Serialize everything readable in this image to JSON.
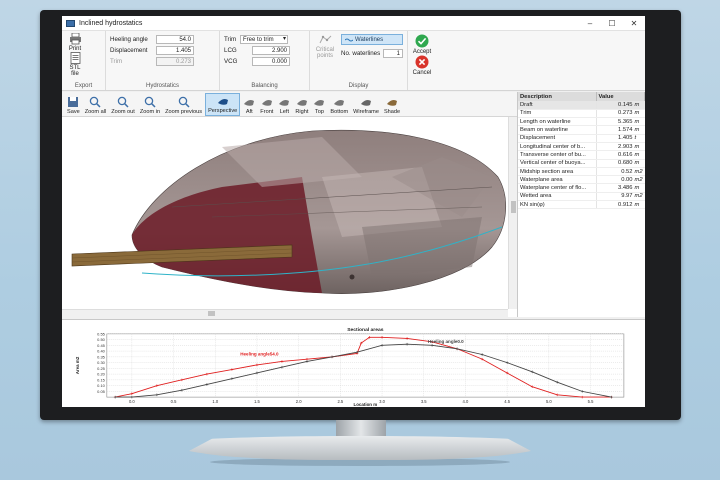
{
  "window": {
    "title": "Inclined hydrostatics",
    "controls": [
      "–",
      "☐",
      "✕"
    ]
  },
  "ribbon": {
    "export": {
      "label": "Export",
      "print": "Print",
      "stl": "STL file"
    },
    "hydrostatics": {
      "label": "Hydrostatics",
      "heeling_label": "Heeling angle",
      "heeling_value": "54.0",
      "displacement_label": "Displacement",
      "displacement_value": "1.405",
      "trim_label": "Trim",
      "trim_value": "0.273"
    },
    "balancing": {
      "label": "Balancing",
      "trim_label": "Trim",
      "trim_select": "Free to trim",
      "lcg_label": "LCG",
      "lcg_value": "2.900",
      "vcg_label": "VCG",
      "vcg_value": "0.000"
    },
    "display": {
      "label": "Display",
      "critical_points": "Critical points",
      "waterlines": "Waterlines",
      "nwl_label": "No. waterlines",
      "nwl_value": "1"
    },
    "actions": {
      "accept": "Accept",
      "cancel": "Cancel"
    }
  },
  "view_toolbar": [
    {
      "label": "Save",
      "icon": "save-icon"
    },
    {
      "label": "Zoom all",
      "icon": "zoom-all-icon"
    },
    {
      "label": "Zoom out",
      "icon": "zoom-out-icon"
    },
    {
      "label": "Zoom in",
      "icon": "zoom-in-icon"
    },
    {
      "label": "Zoom previous",
      "icon": "zoom-previous-icon"
    },
    {
      "label": "Perspective",
      "icon": "perspective-icon",
      "active": true
    },
    {
      "label": "Aft",
      "icon": "aft-view-icon"
    },
    {
      "label": "Front",
      "icon": "front-view-icon"
    },
    {
      "label": "Left",
      "icon": "left-view-icon"
    },
    {
      "label": "Right",
      "icon": "right-view-icon"
    },
    {
      "label": "Top",
      "icon": "top-view-icon"
    },
    {
      "label": "Bottom",
      "icon": "bottom-view-icon"
    },
    {
      "label": "Wireframe",
      "icon": "wireframe-icon"
    },
    {
      "label": "Shade",
      "icon": "shade-icon"
    }
  ],
  "properties": {
    "headers": [
      "Description",
      "Value"
    ],
    "rows": [
      [
        "Draft",
        "0.145",
        "m"
      ],
      [
        "Trim",
        "0.273",
        "m"
      ],
      [
        "Length on waterline",
        "5.365",
        "m"
      ],
      [
        "Beam on waterline",
        "1.574",
        "m"
      ],
      [
        "Displacement",
        "1.405",
        "t"
      ],
      [
        "Longitudinal center of b...",
        "2.903",
        "m"
      ],
      [
        "Transverse center of bu...",
        "0.616",
        "m"
      ],
      [
        "Vertical center of buoya...",
        "0.680",
        "m"
      ],
      [
        "Midship section area",
        "0.52",
        "m2"
      ],
      [
        "Waterplane area",
        "0.00",
        "m2"
      ],
      [
        "Waterplane center of flo...",
        "3.486",
        "m"
      ],
      [
        "Wetted area",
        "9.97",
        "m2"
      ],
      [
        "KN sin(φ)",
        "0.912",
        "m"
      ]
    ]
  },
  "colors": {
    "accent": "#0078d7",
    "curve_heel": "#e02020",
    "curve_zero": "#444444",
    "hull": "#8c7a78",
    "waterline": "#2fb3c8"
  },
  "chart_data": {
    "type": "line",
    "title": "Sectional areas",
    "xlabel": "Location m",
    "ylabel": "Area m2",
    "xlim": [
      -0.3,
      5.9
    ],
    "ylim": [
      0,
      0.55
    ],
    "x_ticks": [
      "0.0",
      "0.5",
      "1.0",
      "1.5",
      "2.0",
      "2.5",
      "3.0",
      "3.5",
      "4.0",
      "4.5",
      "5.0",
      "5.5"
    ],
    "y_ticks": [
      "0.05",
      "0.10",
      "0.15",
      "0.20",
      "0.25",
      "0.30",
      "0.35",
      "0.40",
      "0.45",
      "0.50",
      "0.55"
    ],
    "grid": true,
    "series": [
      {
        "name": "Heeling angle54.0",
        "color": "#e02020",
        "x": [
          -0.2,
          0.0,
          0.3,
          0.6,
          0.9,
          1.2,
          1.5,
          1.8,
          2.1,
          2.4,
          2.7,
          2.75,
          2.85,
          3.0,
          3.3,
          3.6,
          3.9,
          4.2,
          4.5,
          4.8,
          5.1,
          5.4,
          5.75
        ],
        "values": [
          0.0,
          0.03,
          0.1,
          0.15,
          0.2,
          0.24,
          0.28,
          0.31,
          0.33,
          0.35,
          0.38,
          0.47,
          0.52,
          0.52,
          0.51,
          0.48,
          0.42,
          0.33,
          0.21,
          0.09,
          0.02,
          0.0,
          0.0
        ]
      },
      {
        "name": "Heeling angle0.0",
        "color": "#444444",
        "x": [
          -0.2,
          0.0,
          0.3,
          0.6,
          0.9,
          1.2,
          1.5,
          1.8,
          2.1,
          2.4,
          2.7,
          3.0,
          3.3,
          3.6,
          3.9,
          4.2,
          4.5,
          4.8,
          5.1,
          5.4,
          5.75
        ],
        "values": [
          0.0,
          0.0,
          0.02,
          0.06,
          0.11,
          0.16,
          0.21,
          0.26,
          0.31,
          0.35,
          0.39,
          0.45,
          0.46,
          0.45,
          0.42,
          0.37,
          0.3,
          0.22,
          0.13,
          0.05,
          0.0
        ]
      }
    ]
  }
}
